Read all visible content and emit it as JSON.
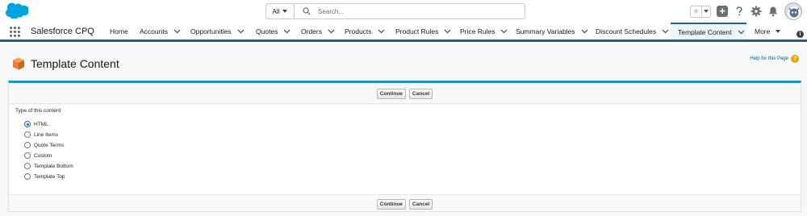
{
  "header": {
    "search_scope": "All",
    "search_placeholder": "Search..."
  },
  "nav": {
    "app_name": "Salesforce CPQ",
    "tabs": [
      {
        "label": "Home",
        "has_menu": false
      },
      {
        "label": "Accounts",
        "has_menu": true
      },
      {
        "label": "Opportunities",
        "has_menu": true
      },
      {
        "label": "Quotes",
        "has_menu": true
      },
      {
        "label": "Orders",
        "has_menu": true
      },
      {
        "label": "Products",
        "has_menu": true
      },
      {
        "label": "Product Rules",
        "has_menu": true
      },
      {
        "label": "Price Rules",
        "has_menu": true
      },
      {
        "label": "Summary Variables",
        "has_menu": true
      },
      {
        "label": "Discount Schedules",
        "has_menu": true
      },
      {
        "label": "Template Content",
        "has_menu": true,
        "active": true
      }
    ],
    "more_label": "More"
  },
  "page": {
    "title": "Template Content",
    "help_link": "Help for this Page"
  },
  "form": {
    "continue_label": "Continue",
    "cancel_label": "Cancel",
    "type_label": "Type of this content",
    "options": [
      "HTML",
      "Line Items",
      "Quote Terms",
      "Custom",
      "Template Bottom",
      "Template Top"
    ],
    "selected": "HTML"
  },
  "colors": {
    "brand_blue": "#1b5f9e",
    "card_accent": "#1797c0",
    "salesforce_cloud": "#00a1e0"
  }
}
